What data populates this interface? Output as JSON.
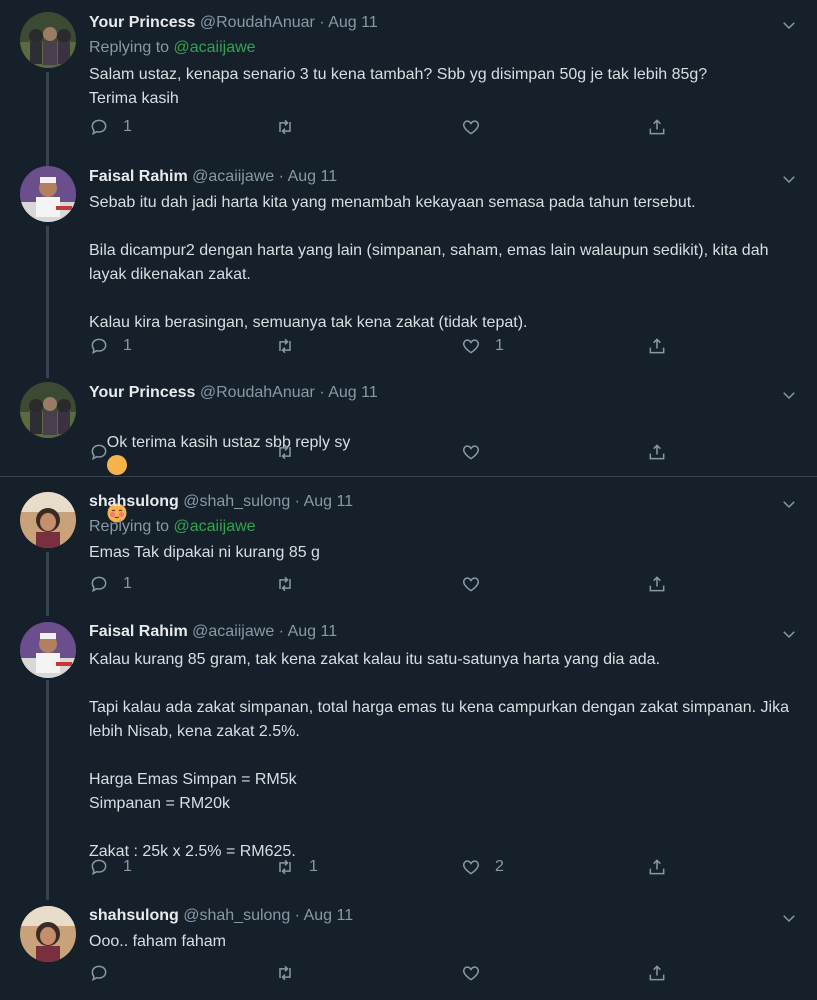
{
  "colors": {
    "bg": "#15202b",
    "link": "#2ea44f",
    "muted": "#8899a6"
  },
  "tweets": [
    {
      "name": "Your Princess",
      "handle": "@RoudahAnuar",
      "date": "Aug 11",
      "replying_label": "Replying to",
      "replying_handle": "@acaiijawe",
      "text": "Salam ustaz, kenapa senario 3 tu kena tambah? Sbb yg disimpan 50g je tak lebih 85g?\nTerima kasih",
      "reply_count": "1",
      "retweet_count": "",
      "like_count": ""
    },
    {
      "name": "Faisal Rahim",
      "handle": "@acaiijawe",
      "date": "Aug 11",
      "text": "Sebab itu dah jadi harta kita yang menambah kekayaan semasa pada tahun tersebut.\n\nBila dicampur2 dengan harta yang lain (simpanan, saham, emas lain walaupun sedikit), kita dah layak dikenakan zakat.\n\nKalau kira berasingan, semuanya tak kena zakat (tidak tepat).",
      "reply_count": "1",
      "retweet_count": "",
      "like_count": "1"
    },
    {
      "name": "Your Princess",
      "handle": "@RoudahAnuar",
      "date": "Aug 11",
      "text": "Ok terima kasih ustaz sbb reply sy",
      "reply_count": "",
      "retweet_count": "",
      "like_count": ""
    },
    {
      "name": "shahsulong",
      "handle": "@shah_sulong",
      "date": "Aug 11",
      "replying_label": "Replying to",
      "replying_handle": "@acaiijawe",
      "text": "Emas Tak dipakai ni kurang 85 g",
      "reply_count": "1",
      "retweet_count": "",
      "like_count": ""
    },
    {
      "name": "Faisal Rahim",
      "handle": "@acaiijawe",
      "date": "Aug 11",
      "text": "Kalau kurang 85 gram, tak kena zakat kalau itu satu-satunya harta yang dia ada.\n\nTapi kalau ada zakat simpanan, total harga emas tu kena campurkan dengan zakat simpanan. Jika lebih Nisab, kena zakat 2.5%.\n\nHarga Emas Simpan = RM5k\nSimpanan = RM20k\n\nZakat : 25k x 2.5% = RM625.",
      "reply_count": "1",
      "retweet_count": "1",
      "like_count": "2"
    },
    {
      "name": "shahsulong",
      "handle": "@shah_sulong",
      "date": "Aug 11",
      "text": "Ooo.. faham faham",
      "reply_count": "",
      "retweet_count": "",
      "like_count": ""
    }
  ]
}
